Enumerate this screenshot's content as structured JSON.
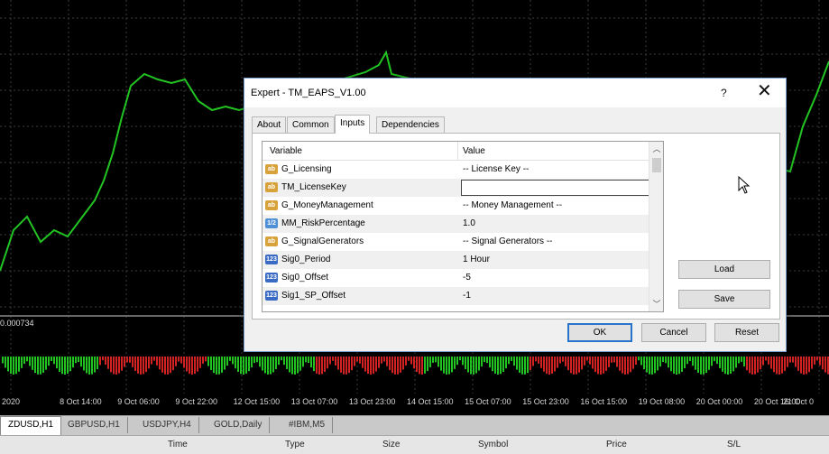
{
  "chart": {
    "indicator_value": "0.000734",
    "time_labels": [
      "2020",
      "8 Oct 14:00",
      "9 Oct 06:00",
      "9 Oct 22:00",
      "12 Oct 15:00",
      "13 Oct 07:00",
      "13 Oct 23:00",
      "14 Oct 15:00",
      "15 Oct 07:00",
      "15 Oct 23:00",
      "16 Oct 15:00",
      "19 Oct 08:00",
      "20 Oct 00:00",
      "20 Oct 16:00",
      "21 Oct 0"
    ],
    "colors": {
      "up": "#22c422",
      "down": "#d22222",
      "grid": "#3b3b3b"
    }
  },
  "chart_tabs": [
    "ZDUSD,H1",
    "GBPUSD,H1",
    "USDJPY,H4",
    "GOLD,Daily",
    "#IBM,M5"
  ],
  "terminal_columns": [
    "Time",
    "Type",
    "Size",
    "Symbol",
    "Price",
    "S/L"
  ],
  "dialog": {
    "title": "Expert - TM_EAPS_V1.00",
    "help_label": "?",
    "close_label": "✕",
    "tabs": [
      "About",
      "Common",
      "Inputs",
      "Dependencies"
    ],
    "active_tab": "Inputs",
    "columns": {
      "variable": "Variable",
      "value": "Value"
    },
    "params": [
      {
        "icon": "ab",
        "icon_text": "ab",
        "name": "G_Licensing",
        "value": "-- License Key --"
      },
      {
        "icon": "ab",
        "icon_text": "ab",
        "name": "TM_LicenseKey",
        "value": ""
      },
      {
        "icon": "ab",
        "icon_text": "ab",
        "name": "G_MoneyManagement",
        "value": "-- Money Management --"
      },
      {
        "icon": "dbl",
        "icon_text": "1/2",
        "name": "MM_RiskPercentage",
        "value": "1.0"
      },
      {
        "icon": "ab",
        "icon_text": "ab",
        "name": "G_SignalGenerators",
        "value": "-- Signal Generators --"
      },
      {
        "icon": "int",
        "icon_text": "123",
        "name": "Sig0_Period",
        "value": "1 Hour"
      },
      {
        "icon": "int",
        "icon_text": "123",
        "name": "Sig0_Offset",
        "value": "-5"
      },
      {
        "icon": "int",
        "icon_text": "123",
        "name": "Sig1_SP_Offset",
        "value": "-1"
      }
    ],
    "buttons": {
      "load": "Load",
      "save": "Save",
      "ok": "OK",
      "cancel": "Cancel",
      "reset": "Reset"
    }
  }
}
